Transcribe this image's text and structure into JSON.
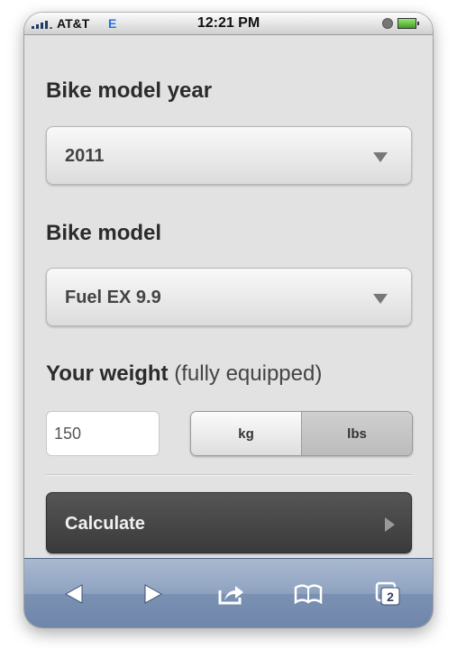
{
  "status_bar": {
    "carrier": "AT&T",
    "network": "E",
    "time": "12:21 PM",
    "icons": [
      "signal-icon",
      "clock-icon",
      "battery-icon"
    ]
  },
  "form": {
    "model_year_label": "Bike model year",
    "model_year_value": "2011",
    "model_label": "Bike model",
    "model_value": "Fuel EX 9.9",
    "weight_label": "Your weight",
    "weight_sublabel": "(fully equipped)",
    "weight_value": "150",
    "unit_kg": "kg",
    "unit_lbs": "lbs",
    "selected_unit": "lbs",
    "calculate_label": "Calculate"
  },
  "toolbar": {
    "tab_count": "2",
    "icons": [
      "back-arrow-icon",
      "forward-arrow-icon",
      "share-icon",
      "bookmarks-icon",
      "tabs-icon"
    ]
  },
  "colors": {
    "background": "#e2e2e3",
    "calculate_button": "#444444",
    "toolbar": "#8ea2c0",
    "network_indicator": "#2b6ee0"
  }
}
